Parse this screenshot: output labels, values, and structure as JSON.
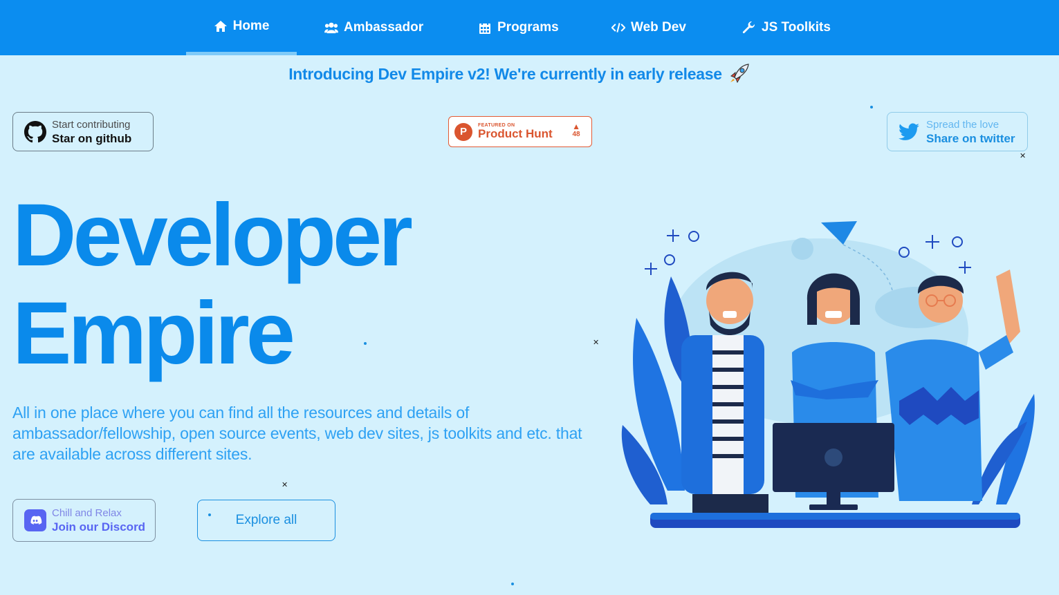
{
  "nav": {
    "items": [
      {
        "label": "Home",
        "icon": "home-icon",
        "active": true
      },
      {
        "label": "Ambassador",
        "icon": "users-icon",
        "active": false
      },
      {
        "label": "Programs",
        "icon": "calendar-icon",
        "active": false
      },
      {
        "label": "Web Dev",
        "icon": "code-icon",
        "active": false
      },
      {
        "label": "JS Toolkits",
        "icon": "wrench-icon",
        "active": false
      }
    ]
  },
  "announcement": "Introducing Dev Empire v2! We're currently in early release",
  "github": {
    "small": "Start contributing",
    "big": "Star on github"
  },
  "producthunt": {
    "featured": "FEATURED ON",
    "name": "Product Hunt",
    "votes": "48"
  },
  "twitter": {
    "small": "Spread the love",
    "big": "Share on twitter"
  },
  "hero": {
    "title_line1": "Developer",
    "title_line2": "Empire",
    "description": "All in one place where you can find all the resources and details of ambassador/fellowship, open source events, web dev sites, js toolkits and etc. that are available across different sites."
  },
  "discord": {
    "small": "Chill and Relax",
    "big": "Join our Discord"
  },
  "explore_label": "Explore all",
  "colors": {
    "nav_bg": "#0b8df0",
    "page_bg": "#d4f1fd",
    "accent": "#0a8aeb",
    "producthunt": "#da552f",
    "discord": "#5865f2"
  }
}
